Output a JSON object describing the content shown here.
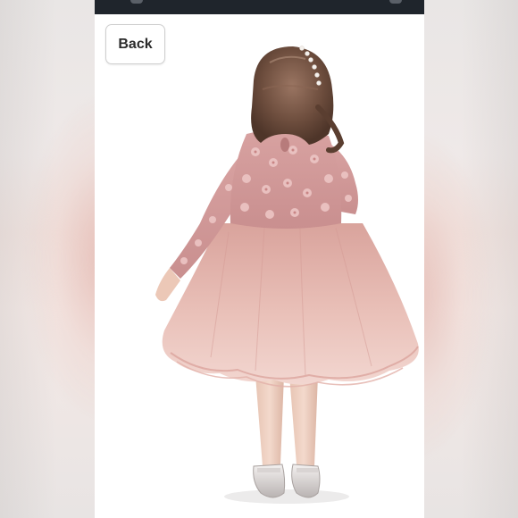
{
  "toolbar": {
    "back_label": "Back"
  },
  "product_image": {
    "subject": "girl-in-pink-floral-tulle-dress"
  },
  "colors": {
    "status_bar": "#1f252c",
    "dress_pink": "#e6b5ad",
    "bodice_pink": "#d99f9c",
    "background": "#ffffff"
  }
}
